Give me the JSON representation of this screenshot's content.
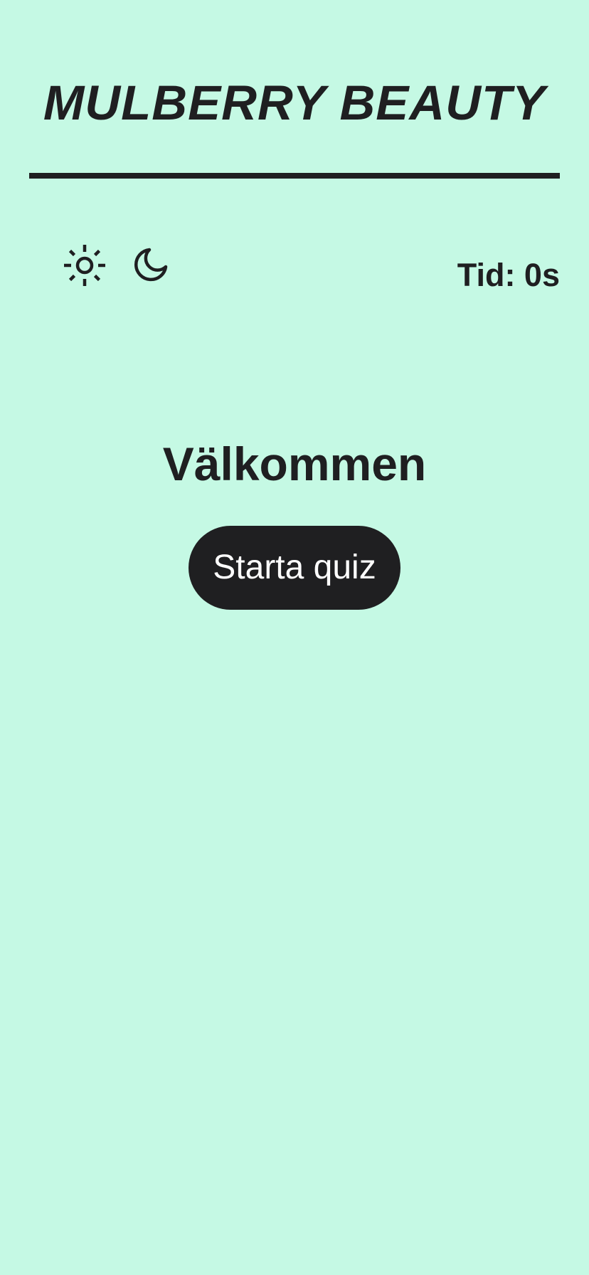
{
  "header": {
    "brand": "MULBERRY BEAUTY"
  },
  "controls": {
    "light_icon": "sun-icon",
    "dark_icon": "moon-icon",
    "timer_text": "Tid: 0s"
  },
  "main": {
    "heading": "Välkommen",
    "start_button_label": "Starta quiz"
  },
  "colors": {
    "background": "#c5f9e4",
    "foreground": "#1f1f21",
    "button_text": "#ffffff"
  }
}
